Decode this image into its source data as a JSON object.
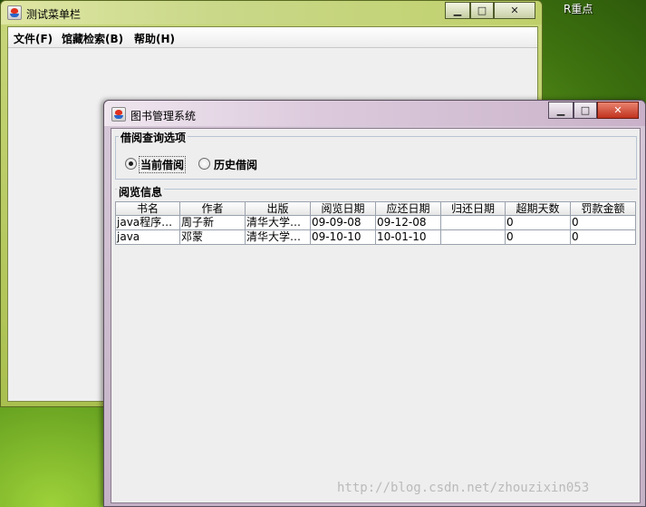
{
  "desktop": {
    "label": "R重点"
  },
  "window1": {
    "title": "测试菜单栏",
    "controls": {
      "minimize": "▁",
      "maximize": "□",
      "close": "✕"
    },
    "menu": [
      {
        "label": "文件(F)"
      },
      {
        "label": "馆藏检索(B)"
      },
      {
        "label": "帮助(H)"
      }
    ]
  },
  "window2": {
    "title": "图书管理系统",
    "controls": {
      "minimize": "▁",
      "maximize": "□",
      "close": "✕"
    },
    "query_group": {
      "title": "借阅查询选项",
      "options": [
        {
          "label": "当前借阅",
          "checked": true
        },
        {
          "label": "历史借阅",
          "checked": false
        }
      ]
    },
    "info_group": {
      "title": "阅览信息"
    },
    "table": {
      "columns": [
        "书名",
        "作者",
        "出版",
        "阅览日期",
        "应还日期",
        "归还日期",
        "超期天数",
        "罚款金额"
      ],
      "rows": [
        [
          "java程序设计",
          "周子新",
          "清华大学出...",
          "09-09-08",
          "09-12-08",
          "",
          "0",
          "0"
        ],
        [
          "java",
          "邓蒙",
          "清华大学出...",
          "09-10-10",
          "10-01-10",
          "",
          "0",
          "0"
        ]
      ]
    }
  },
  "watermark": "http://blog.csdn.net/zhouzixin053"
}
